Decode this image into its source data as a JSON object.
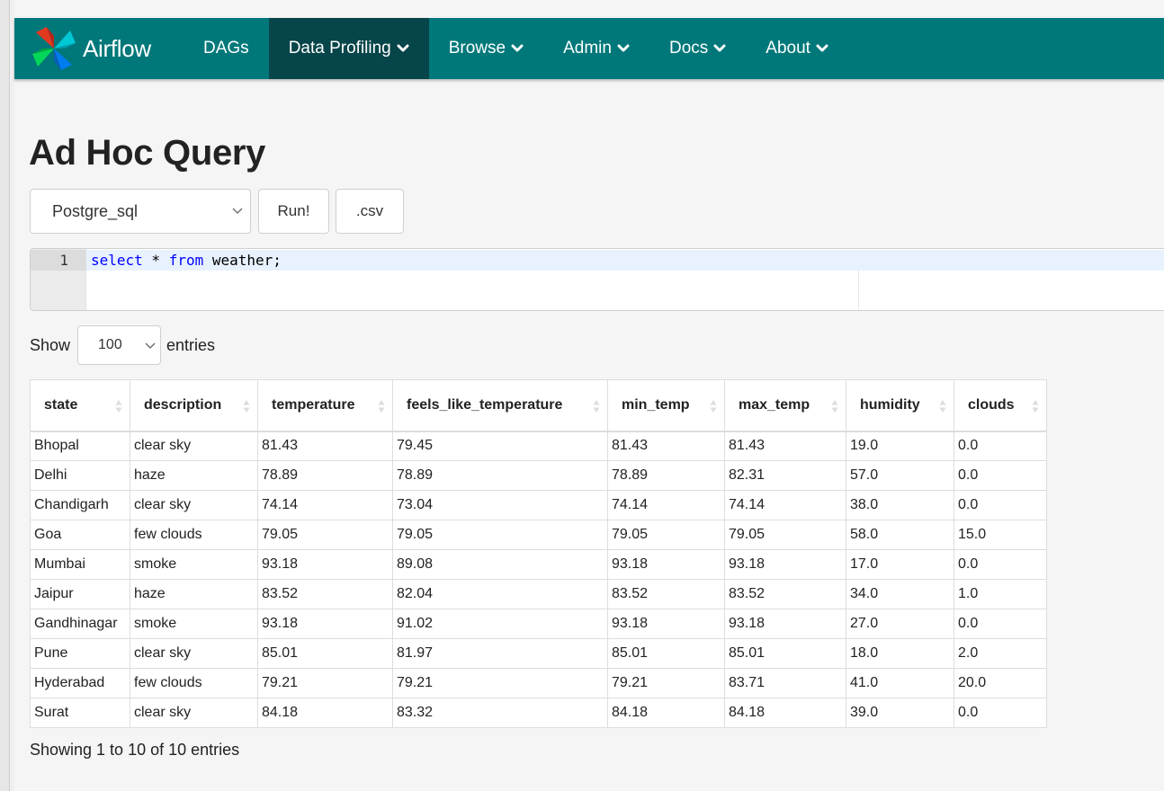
{
  "nav": {
    "brand": "Airflow",
    "items": [
      {
        "label": "DAGs",
        "dropdown": false,
        "active": false
      },
      {
        "label": "Data Profiling",
        "dropdown": true,
        "active": true
      },
      {
        "label": "Browse",
        "dropdown": true,
        "active": false
      },
      {
        "label": "Admin",
        "dropdown": true,
        "active": false
      },
      {
        "label": "Docs",
        "dropdown": true,
        "active": false
      },
      {
        "label": "About",
        "dropdown": true,
        "active": false
      }
    ],
    "bar_color": "#00787a",
    "active_color": "#064549"
  },
  "page": {
    "title": "Ad Hoc Query"
  },
  "query_form": {
    "connection": "Postgre_sql",
    "run_label": "Run!",
    "csv_label": ".csv"
  },
  "editor": {
    "line_number": "1",
    "code_keyword_1": "select",
    "code_rest_1": " * ",
    "code_keyword_2": "from",
    "code_rest_2": " weather;"
  },
  "table_controls": {
    "show_label": "Show",
    "page_length": "100",
    "entries_label": "entries",
    "info": "Showing 1 to 10 of 10 entries"
  },
  "table": {
    "columns": [
      "state",
      "description",
      "temperature",
      "feels_like_temperature",
      "min_temp",
      "max_temp",
      "humidity",
      "clouds"
    ],
    "rows": [
      [
        "Bhopal",
        "clear sky",
        "81.43",
        "79.45",
        "81.43",
        "81.43",
        "19.0",
        "0.0"
      ],
      [
        "Delhi",
        "haze",
        "78.89",
        "78.89",
        "78.89",
        "82.31",
        "57.0",
        "0.0"
      ],
      [
        "Chandigarh",
        "clear sky",
        "74.14",
        "73.04",
        "74.14",
        "74.14",
        "38.0",
        "0.0"
      ],
      [
        "Goa",
        "few clouds",
        "79.05",
        "79.05",
        "79.05",
        "79.05",
        "58.0",
        "15.0"
      ],
      [
        "Mumbai",
        "smoke",
        "93.18",
        "89.08",
        "93.18",
        "93.18",
        "17.0",
        "0.0"
      ],
      [
        "Jaipur",
        "haze",
        "83.52",
        "82.04",
        "83.52",
        "83.52",
        "34.0",
        "1.0"
      ],
      [
        "Gandhinagar",
        "smoke",
        "93.18",
        "91.02",
        "93.18",
        "93.18",
        "27.0",
        "0.0"
      ],
      [
        "Pune",
        "clear sky",
        "85.01",
        "81.97",
        "85.01",
        "85.01",
        "18.0",
        "2.0"
      ],
      [
        "Hyderabad",
        "few clouds",
        "79.21",
        "79.21",
        "79.21",
        "83.71",
        "41.0",
        "20.0"
      ],
      [
        "Surat",
        "clear sky",
        "84.18",
        "83.32",
        "84.18",
        "84.18",
        "39.0",
        "0.0"
      ]
    ]
  }
}
